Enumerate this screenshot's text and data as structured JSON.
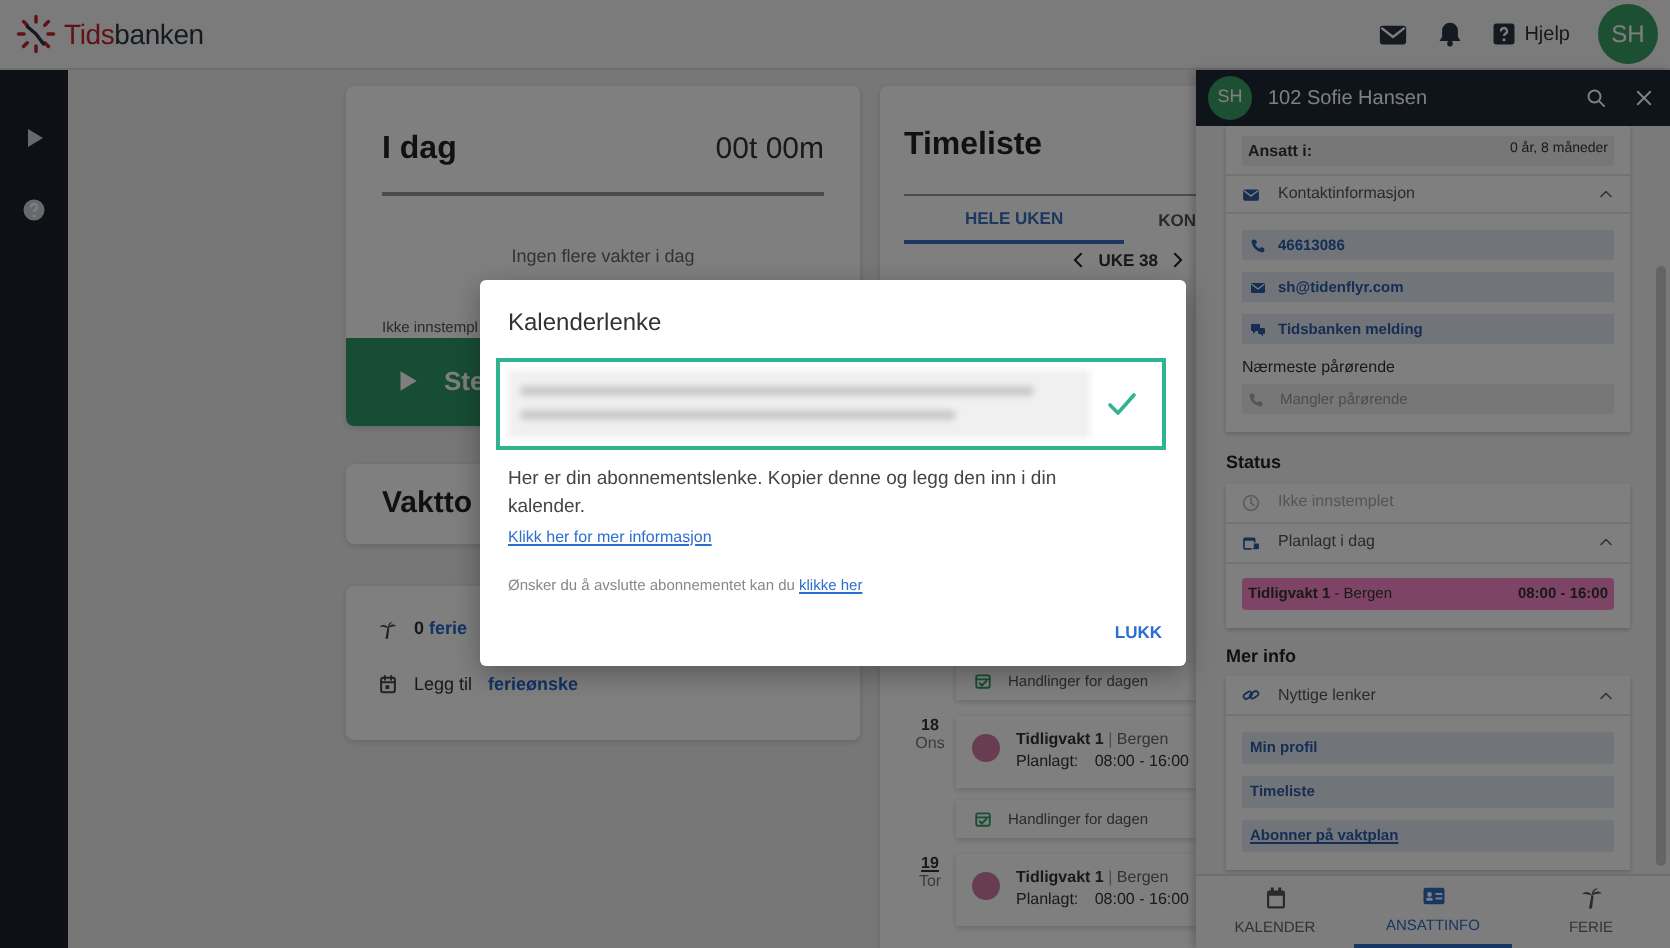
{
  "topbar": {
    "logo_accent": "Tids",
    "logo_rest": "banken",
    "help_label": "Hjelp",
    "avatar": "SH"
  },
  "today_card": {
    "title": "I dag",
    "duration": "00t 00m",
    "message": "Ingen flere vakter i dag",
    "status": "Ikke innstempl",
    "button": "Ste"
  },
  "shift_card": {
    "title": "Vaktto"
  },
  "vacation_card": {
    "count": "0",
    "count_link": "ferie",
    "add_text": "Legg til",
    "add_link": "ferieønske"
  },
  "timeliste": {
    "title": "Timeliste",
    "tabs": [
      {
        "label": "HELE UKEN",
        "selected": true
      },
      {
        "label": "KON",
        "selected": false
      }
    ],
    "week": "UKE 38",
    "entries": [
      {
        "kind": "actions",
        "label": "Handlinger for dagen"
      },
      {
        "kind": "shift",
        "day": "18",
        "weekday": "Ons",
        "today": false,
        "title": "Tidligvakt 1",
        "separator": "|",
        "location": "Bergen",
        "planned_label": "Planlagt:",
        "time": "08:00 - 16:00",
        "color": "#683d53"
      },
      {
        "kind": "actions",
        "label": "Handlinger for dagen"
      },
      {
        "kind": "shift",
        "day": "19",
        "weekday": "Tor",
        "today": true,
        "title": "Tidligvakt 1",
        "separator": "|",
        "location": "Bergen",
        "planned_label": "Planlagt:",
        "time": "08:00 - 16:00",
        "color": "#683d53"
      }
    ]
  },
  "panel": {
    "avatar": "SH",
    "name": "102 Sofie Hansen",
    "employed": {
      "label": "Ansatt i:",
      "value": "0 år, 8 måneder"
    },
    "contact": {
      "title": "Kontaktinformasjon",
      "expanded": true,
      "links": [
        {
          "kind": "phone",
          "label": "46613086"
        },
        {
          "kind": "email",
          "label": "sh@tidenflyr.com"
        },
        {
          "kind": "message",
          "label": "Tidsbanken melding"
        }
      ]
    },
    "next_of_kin": {
      "title": "Nærmeste pårørende",
      "value": "Mangler pårørende"
    },
    "status": {
      "title": "Status",
      "clock_status": "Ikke innstemplet",
      "planned": {
        "title": "Planlagt i dag",
        "expanded": true,
        "shifts": [
          {
            "title": "Tidligvakt 1",
            "separator": "-",
            "location": "Bergen",
            "time": "08:00 - 16:00",
            "color": "#7e4466"
          }
        ]
      }
    },
    "more_info": {
      "title": "Mer info",
      "section": {
        "title": "Nyttige lenker",
        "expanded": true,
        "links": [
          "Min profil",
          "Timeliste",
          "Abonner på vaktplan"
        ]
      }
    },
    "bottom_nav": [
      {
        "label": "KALENDER",
        "selected": false
      },
      {
        "label": "ANSATTINFO",
        "selected": true
      },
      {
        "label": "FERIE",
        "selected": false
      }
    ]
  },
  "modal": {
    "title": "Kalenderlenke",
    "link_copied": true,
    "description": "Her er din abonnementslenke. Kopier denne og legg den inn i din kalender.",
    "info_link": "Klikk her for mer informasjon",
    "unsubscribe_text": "Ønsker du å avslutte abonnementet kan du",
    "unsubscribe_link": "klikke her",
    "close_button": "LUKK"
  }
}
